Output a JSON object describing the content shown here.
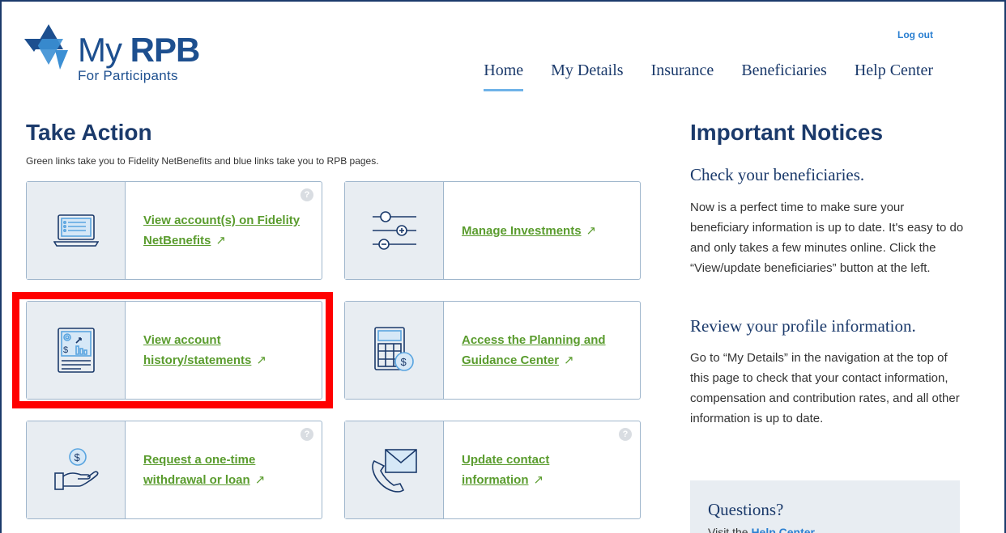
{
  "header": {
    "logo_my": "My",
    "logo_rpb": "RPB",
    "logo_sub": "For Participants",
    "logout": "Log out",
    "nav": [
      {
        "label": "Home",
        "active": true
      },
      {
        "label": "My Details"
      },
      {
        "label": "Insurance"
      },
      {
        "label": "Beneficiaries"
      },
      {
        "label": "Help Center"
      }
    ]
  },
  "take_action": {
    "title": "Take Action",
    "intro": "Green links take you to Fidelity NetBenefits and blue links take you to RPB pages.",
    "cards": [
      {
        "line1": "View account(s) on Fidelity",
        "line2": "NetBenefits",
        "icon": "laptop-icon",
        "help": "?"
      },
      {
        "line1": "Manage Investments",
        "line2": "",
        "icon": "sliders-icon"
      },
      {
        "line1": "View account",
        "line2": "history/statements",
        "icon": "statement-icon"
      },
      {
        "line1": "Access the Planning and",
        "line2": "Guidance Center",
        "icon": "calculator-icon"
      },
      {
        "line1": "Request a one-time",
        "line2": "withdrawal or loan",
        "icon": "hand-coin-icon",
        "help": "?"
      },
      {
        "line1": "Update contact",
        "line2": "information",
        "icon": "envelope-phone-icon",
        "help": "?"
      }
    ],
    "arrow": "↗"
  },
  "notices": {
    "title": "Important Notices",
    "items": [
      {
        "heading": "Check your beneficiaries.",
        "text": "Now is a perfect time to make sure your beneficiary information is up to date. It's easy to do and only takes a few minutes online. Click the “View/update beneficiaries” button at the left."
      },
      {
        "heading": "Review your profile information.",
        "text": "Go to “My Details” in the navigation at the top of this page to check that your contact information, compensation and contribution rates, and all other information is up to date."
      }
    ]
  },
  "questions": {
    "title": "Questions?",
    "text_prefix": "Visit the",
    "link": "Help Center"
  },
  "colors": {
    "navy": "#1b3a6b",
    "green_link": "#5a9c2e",
    "blue_link": "#2a7fd1",
    "highlight": "#ff0000"
  }
}
